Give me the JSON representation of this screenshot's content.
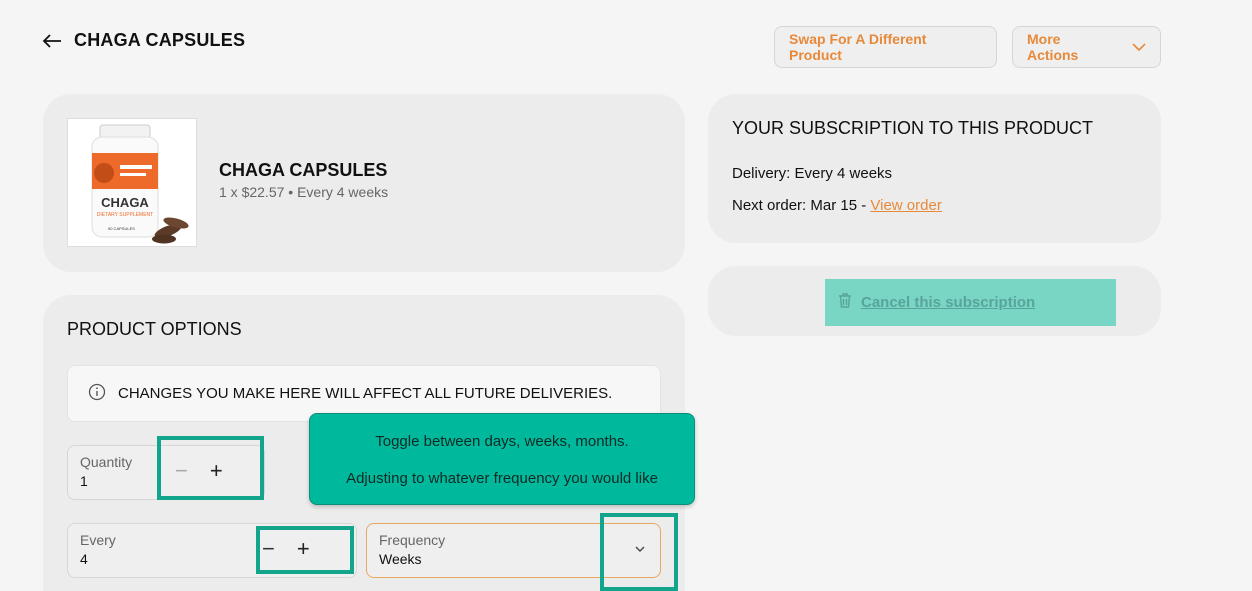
{
  "header": {
    "title": "CHAGA CAPSULES",
    "swap_label": "Swap For A Different Product",
    "more_label": "More Actions"
  },
  "product": {
    "name": "CHAGA CAPSULES",
    "meta": "1 x $22.57 • Every 4 weeks",
    "image_label": "CHAGA",
    "image_sublabel": "DIETARY SUPPLEMENT",
    "image_count": "90 CAPSULES"
  },
  "subscription": {
    "title": "YOUR SUBSCRIPTION TO THIS PRODUCT",
    "delivery": "Delivery: Every 4 weeks",
    "next_order": "Next order: Mar 15",
    "separator": "-",
    "view_order": "View order"
  },
  "cancel": {
    "label": "Cancel this subscription"
  },
  "options": {
    "title": "PRODUCT OPTIONS",
    "notice": "CHANGES YOU MAKE HERE WILL AFFECT ALL FUTURE DELIVERIES.",
    "quantity": {
      "label": "Quantity",
      "value": "1"
    },
    "every": {
      "label": "Every",
      "value": "4"
    },
    "frequency": {
      "label": "Frequency",
      "value": "Weeks"
    }
  },
  "tooltip": {
    "line1": "Toggle between days, weeks, months.",
    "line2": "Adjusting to whatever frequency you would like"
  },
  "colors": {
    "accent": "#e8893a",
    "highlight": "#12a58c",
    "tooltip_bg": "#00b89c"
  }
}
